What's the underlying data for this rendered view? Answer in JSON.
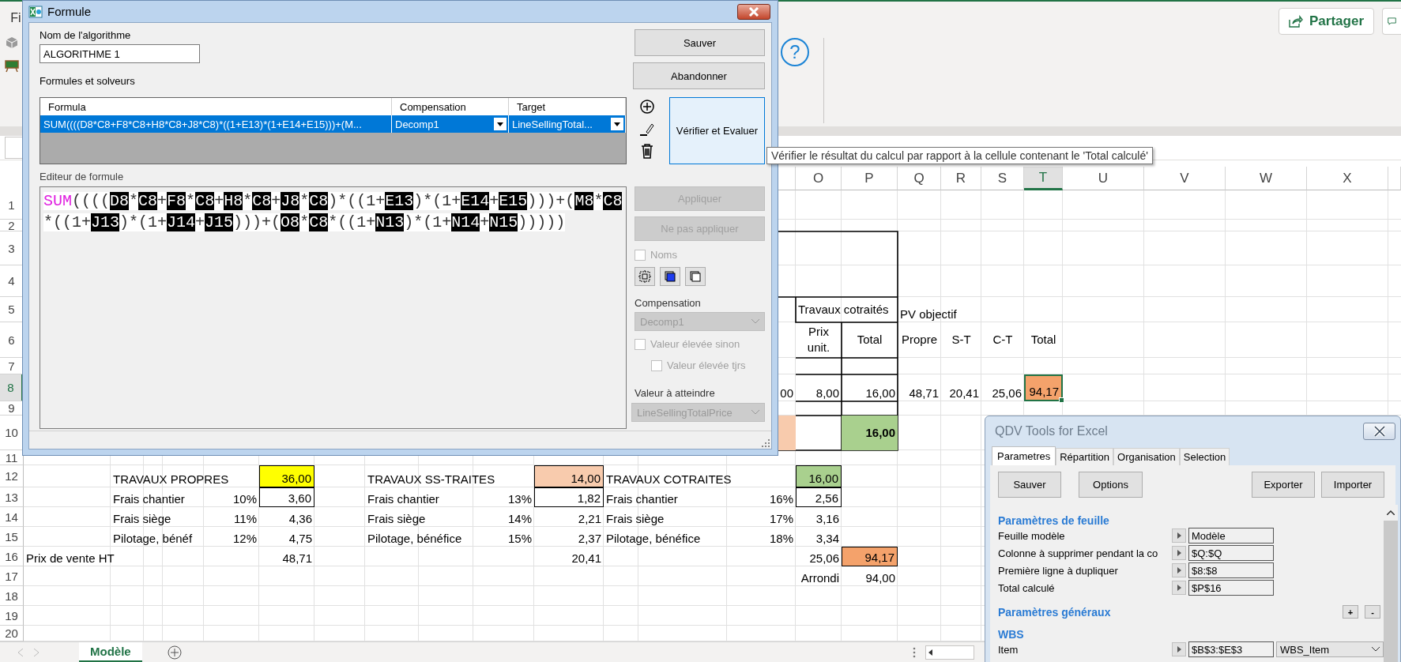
{
  "ribbon": {
    "menu_tab": "Fi",
    "help": "?",
    "share_button": "Partager"
  },
  "sheet": {
    "column_headers": [
      {
        "label": "O",
        "selected": false
      },
      {
        "label": "P",
        "selected": false
      },
      {
        "label": "Q",
        "selected": false
      },
      {
        "label": "R",
        "selected": false
      },
      {
        "label": "S",
        "selected": false
      },
      {
        "label": "T",
        "selected": true
      },
      {
        "label": "U",
        "selected": false
      },
      {
        "label": "V",
        "selected": false
      },
      {
        "label": "W",
        "selected": false
      },
      {
        "label": "X",
        "selected": false
      }
    ],
    "row_headers": [
      {
        "label": "1",
        "selected": false
      },
      {
        "label": "2",
        "selected": false
      },
      {
        "label": "3",
        "selected": false
      },
      {
        "label": "4",
        "selected": false
      },
      {
        "label": "5",
        "selected": false
      },
      {
        "label": "6",
        "selected": false
      },
      {
        "label": "7",
        "selected": false
      },
      {
        "label": "8",
        "selected": true
      },
      {
        "label": "9",
        "selected": false
      },
      {
        "label": "10",
        "selected": false
      },
      {
        "label": "11",
        "selected": false
      },
      {
        "label": "12",
        "selected": false
      },
      {
        "label": "13",
        "selected": false
      },
      {
        "label": "14",
        "selected": false
      },
      {
        "label": "15",
        "selected": false
      },
      {
        "label": "16",
        "selected": false
      },
      {
        "label": "17",
        "selected": false
      },
      {
        "label": "18",
        "selected": false
      },
      {
        "label": "19",
        "selected": false
      },
      {
        "label": "20",
        "selected": false
      }
    ],
    "top_table": {
      "group_title": "Travaux cotraités",
      "objective_title": "PV objectif",
      "headers": [
        "Prix unit.",
        "Total",
        "Propre",
        "S-T",
        "C-T",
        "Total"
      ],
      "values": [
        "00",
        "8,00",
        "16,00",
        "48,71",
        "20,41",
        "25,06",
        "94,17"
      ],
      "total": "16,00"
    },
    "blocks": [
      {
        "title": "TRAVAUX PROPRES",
        "total": "36,00",
        "color": "#ffff00",
        "lines": [
          {
            "label": "Frais chantier",
            "rate": "10%",
            "value": "3,60"
          },
          {
            "label": "Frais siège",
            "rate": "11%",
            "value": "4,36"
          },
          {
            "label": "Pilotage, bénéf",
            "rate": "12%",
            "value": "4,75"
          }
        ],
        "sale_price": "48,71"
      },
      {
        "title": "TRAVAUX SS-TRAITES",
        "total": "14,00",
        "color": "#f8cbad",
        "lines": [
          {
            "label": "Frais chantier",
            "rate": "13%",
            "value": "1,82"
          },
          {
            "label": "Frais siège",
            "rate": "14%",
            "value": "2,21"
          },
          {
            "label": "Pilotage, bénéfice",
            "rate": "15%",
            "value": "2,37"
          }
        ],
        "sale_price": "20,41"
      },
      {
        "title": "TRAVAUX COTRAITES",
        "total": "16,00",
        "color": "#a9d08e",
        "lines": [
          {
            "label": "Frais chantier",
            "rate": "16%",
            "value": "2,56"
          },
          {
            "label": "Frais siège",
            "rate": "17%",
            "value": "3,16"
          },
          {
            "label": "Pilotage, bénéfice",
            "rate": "18%",
            "value": "3,34"
          }
        ],
        "sale_price": "25,06"
      }
    ],
    "sale_label": "Prix de vente HT",
    "grand_total": "94,17",
    "rounding_label": "Arrondi",
    "rounded_total": "94,00",
    "tabs": [
      {
        "label": "Modèle",
        "selected": true
      }
    ]
  },
  "formula_dialog": {
    "title": "Formule",
    "name_label": "Nom de l'algorithme",
    "name_value": "ALGORITHME 1",
    "formulas_label": "Formules et solveurs",
    "top_buttons": [
      "Sauver",
      "Abandonner"
    ],
    "table": {
      "columns": [
        "Formula",
        "Compensation",
        "Target"
      ],
      "rows": [
        {
          "formula": "SUM((((D8*C8+F8*C8+H8*C8+J8*C8)*((1+E13)*(1+E14+E15)))+(M...",
          "compensation": "Decomp1",
          "target": "LineSellingTotal...",
          "selected": true
        }
      ]
    },
    "verify_button": {
      "label": "Vérifier et Evaluer",
      "hovered": true
    },
    "editor_label": "Editeur de formule",
    "editor_tokens": [
      {
        "text": "SUM",
        "kind": "function"
      },
      {
        "text": "((((",
        "kind": "operator"
      },
      {
        "text": "D8",
        "kind": "reference"
      },
      {
        "text": "*",
        "kind": "operator"
      },
      {
        "text": "C8",
        "kind": "reference"
      },
      {
        "text": "+",
        "kind": "operator"
      },
      {
        "text": "F8",
        "kind": "reference"
      },
      {
        "text": "*",
        "kind": "operator"
      },
      {
        "text": "C8",
        "kind": "reference"
      },
      {
        "text": "+",
        "kind": "operator"
      },
      {
        "text": "H8",
        "kind": "reference"
      },
      {
        "text": "*",
        "kind": "operator"
      },
      {
        "text": "C8",
        "kind": "reference"
      },
      {
        "text": "+",
        "kind": "operator"
      },
      {
        "text": "J8",
        "kind": "reference"
      },
      {
        "text": "*",
        "kind": "operator"
      },
      {
        "text": "C8",
        "kind": "reference"
      },
      {
        "text": ")*((1+",
        "kind": "operator"
      },
      {
        "text": "E13",
        "kind": "reference"
      },
      {
        "text": ")*(1+",
        "kind": "operator"
      },
      {
        "text": "E14",
        "kind": "reference"
      },
      {
        "text": "+",
        "kind": "operator"
      },
      {
        "text": "E15",
        "kind": "reference"
      },
      {
        "text": ")))+(",
        "kind": "operator"
      },
      {
        "text": "M8",
        "kind": "reference"
      },
      {
        "text": "*",
        "kind": "operator"
      },
      {
        "text": "C8",
        "kind": "reference"
      },
      {
        "text": "*((1+",
        "kind": "operator"
      },
      {
        "text": "J13",
        "kind": "reference"
      },
      {
        "text": ")*(1+",
        "kind": "operator"
      },
      {
        "text": "J14",
        "kind": "reference"
      },
      {
        "text": "+",
        "kind": "operator"
      },
      {
        "text": "J15",
        "kind": "reference"
      },
      {
        "text": ")))+(",
        "kind": "operator"
      },
      {
        "text": "O8",
        "kind": "reference"
      },
      {
        "text": "*",
        "kind": "operator"
      },
      {
        "text": "C8",
        "kind": "reference"
      },
      {
        "text": "*((1+",
        "kind": "operator"
      },
      {
        "text": "N13",
        "kind": "reference"
      },
      {
        "text": ")*(1+",
        "kind": "operator"
      },
      {
        "text": "N14",
        "kind": "reference"
      },
      {
        "text": "+",
        "kind": "operator"
      },
      {
        "text": "N15",
        "kind": "reference"
      },
      {
        "text": ")))))",
        "kind": "operator"
      }
    ],
    "side_buttons": [
      {
        "label": "Appliquer",
        "disabled": true
      },
      {
        "label": "Ne pas appliquer",
        "disabled": true
      }
    ],
    "names_checkbox": {
      "label": "Noms",
      "checked": false,
      "disabled": true
    },
    "compensation_label": "Compensation",
    "compensation_select": {
      "value": "Decomp1",
      "disabled": true
    },
    "options": [
      {
        "label": "Valeur élevée sinon",
        "checked": false,
        "disabled": true
      },
      {
        "label": "Valeur élevée tjrs",
        "checked": false,
        "disabled": true
      }
    ],
    "target_label": "Valeur à atteindre",
    "target_select": {
      "value": "LineSellingTotalPrice",
      "disabled": true
    }
  },
  "tooltip": "Vérifier le résultat du calcul par rapport à la cellule contenant le 'Total calculé'",
  "qdv_panel": {
    "title": "QDV Tools for Excel",
    "tabs": [
      {
        "label": "Parametres",
        "selected": true
      },
      {
        "label": "Répartition",
        "selected": false
      },
      {
        "label": "Organisation",
        "selected": false
      },
      {
        "label": "Selection",
        "selected": false
      }
    ],
    "buttons": [
      "Sauver",
      "Options",
      "Exporter",
      "Importer"
    ],
    "sections": [
      {
        "heading": "Paramètres de feuille",
        "fields": [
          {
            "label": "Feuille modèle",
            "value": "Modèle"
          },
          {
            "label": "Colonne à supprimer pendant la co",
            "value": "$Q:$Q"
          },
          {
            "label": "Première ligne à dupliquer",
            "value": "$8:$8"
          },
          {
            "label": "Total calculé",
            "value": "$P$16"
          }
        ]
      },
      {
        "heading": "Paramètres généraux",
        "actions": [
          "+",
          "-"
        ]
      },
      {
        "heading": "WBS",
        "fields": [
          {
            "label": "Item",
            "value": "$B$3:$E$3",
            "option": "WBS_Item"
          }
        ]
      }
    ]
  }
}
